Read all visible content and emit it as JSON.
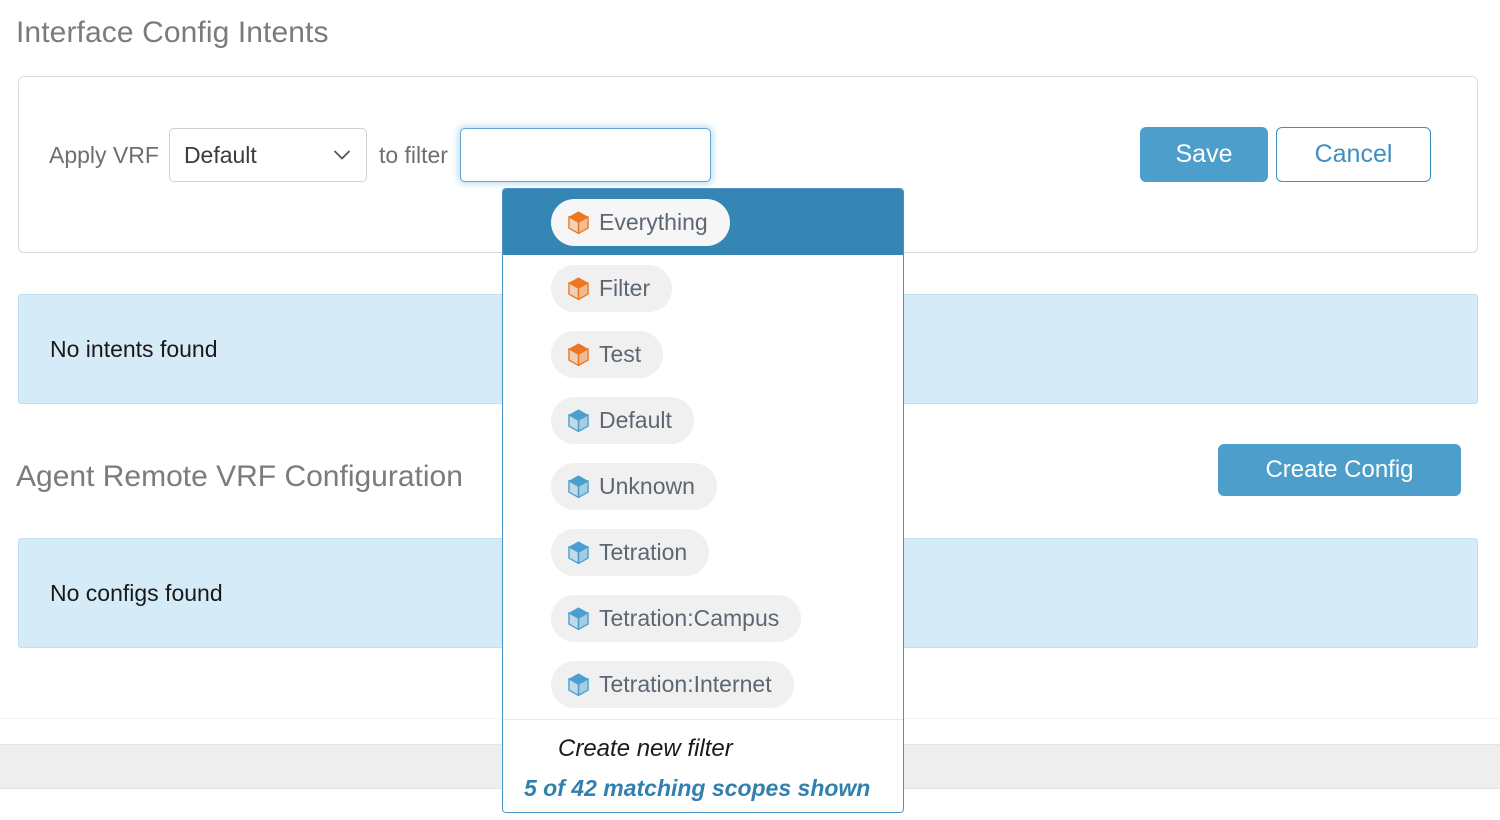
{
  "page": {
    "title": "Interface Config Intents"
  },
  "vrf_form": {
    "apply_label": "Apply VRF",
    "to_filter_label": "to filter",
    "vrf_select": {
      "value": "Default",
      "caret_icon": "chevron-down-icon"
    },
    "filter_input": {
      "value": "",
      "placeholder": ""
    },
    "save_label": "Save",
    "cancel_label": "Cancel"
  },
  "intents_section": {
    "empty_message": "No intents found"
  },
  "configs_section": {
    "heading": "Agent Remote VRF Configuration",
    "create_button_label": "Create Config",
    "empty_message": "No configs found"
  },
  "scope_dropdown": {
    "items": [
      {
        "label": "Everything",
        "icon": "cube-icon",
        "icon_color": "#ec7723",
        "selected": true
      },
      {
        "label": "Filter",
        "icon": "cube-icon",
        "icon_color": "#ec7723",
        "selected": false
      },
      {
        "label": "Test",
        "icon": "cube-icon",
        "icon_color": "#ec7723",
        "selected": false
      },
      {
        "label": "Default",
        "icon": "cube-icon",
        "icon_color": "#4a9fd0",
        "selected": false
      },
      {
        "label": "Unknown",
        "icon": "cube-icon",
        "icon_color": "#4a9fd0",
        "selected": false
      },
      {
        "label": "Tetration",
        "icon": "cube-icon",
        "icon_color": "#4a9fd0",
        "selected": false
      },
      {
        "label": "Tetration:Campus",
        "icon": "cube-icon",
        "icon_color": "#4a9fd0",
        "selected": false
      },
      {
        "label": "Tetration:Internet",
        "icon": "cube-icon",
        "icon_color": "#4a9fd0",
        "selected": false
      }
    ],
    "create_new_filter_label": "Create new filter",
    "matching_count_label": "5 of 42 matching scopes shown"
  },
  "colors": {
    "accent_blue": "#4d9ecb",
    "selected_row_blue": "#3585b5",
    "info_banner_bg": "#d5ecf8",
    "cube_orange": "#ec7723",
    "cube_blue": "#4a9fd0",
    "heading_gray": "#7b7b7b"
  }
}
